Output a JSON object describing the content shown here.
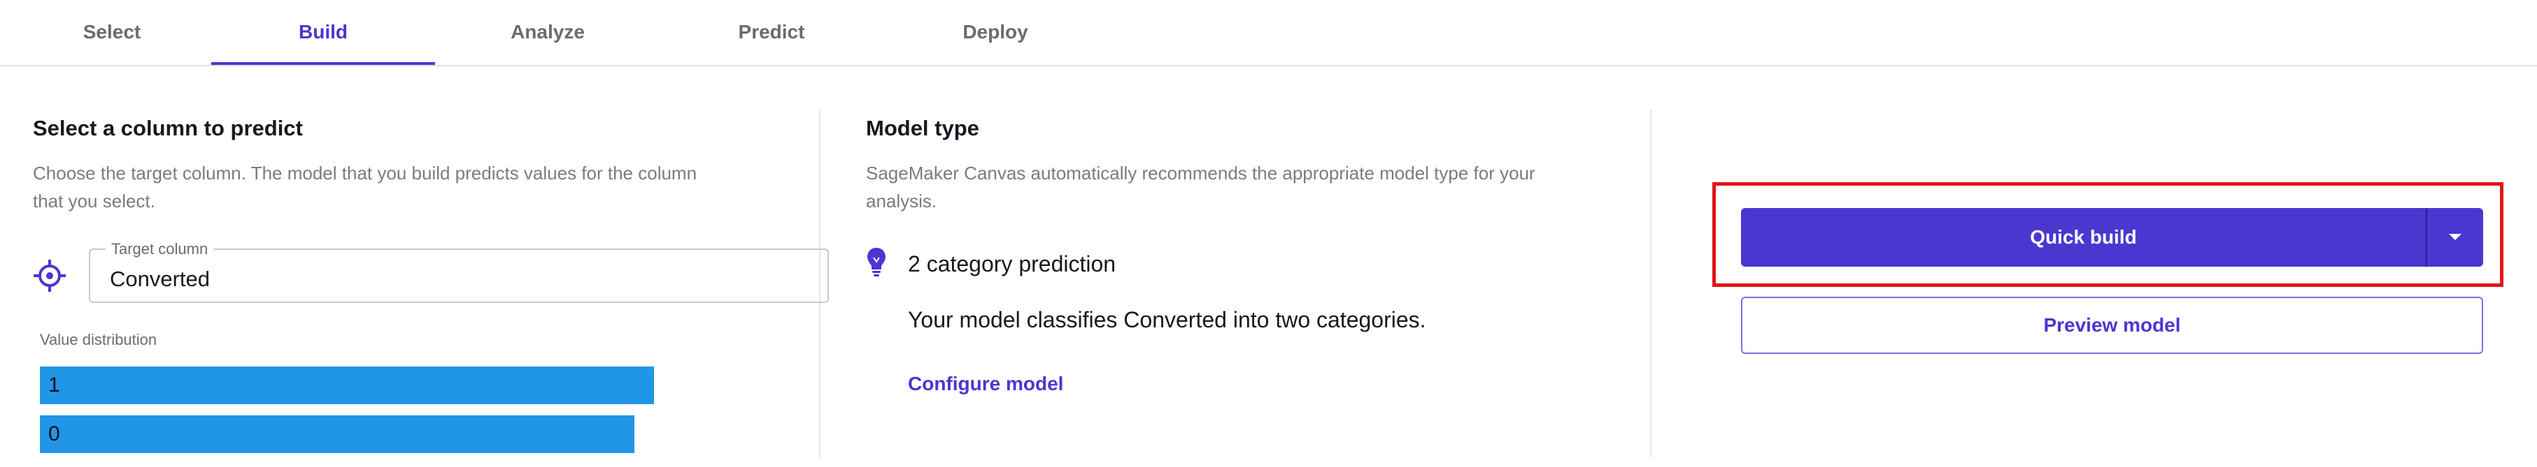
{
  "tabs": [
    {
      "label": "Select",
      "active": false
    },
    {
      "label": "Build",
      "active": true
    },
    {
      "label": "Analyze",
      "active": false
    },
    {
      "label": "Predict",
      "active": false
    },
    {
      "label": "Deploy",
      "active": false
    }
  ],
  "target_section": {
    "title": "Select a column to predict",
    "description_line1": "Choose the target column. The model that you build predicts values for the column",
    "description_line2": "that you select.",
    "target_field": {
      "label": "Target column",
      "value": "Converted"
    },
    "distribution": {
      "label": "Value distribution",
      "bars": [
        {
          "label": "1",
          "fraction": 0.61
        },
        {
          "label": "0",
          "fraction": 0.59
        }
      ]
    }
  },
  "model_section": {
    "title": "Model type",
    "description_line1": "SageMaker Canvas automatically recommends the appropriate model type for your",
    "description_line2": "analysis.",
    "prediction_type": "2 category prediction",
    "prediction_desc": "Your model classifies Converted into two categories.",
    "configure_link": "Configure model"
  },
  "build_section": {
    "quick_build_label": "Quick build",
    "preview_label": "Preview model"
  },
  "icons": {
    "target": "crosshair-target-icon",
    "bulb": "lightbulb-icon",
    "dropdown": "caret-down-icon"
  },
  "colors": {
    "accent": "#4b36cf",
    "bar": "#2196e6",
    "highlight": "#e3141b"
  }
}
